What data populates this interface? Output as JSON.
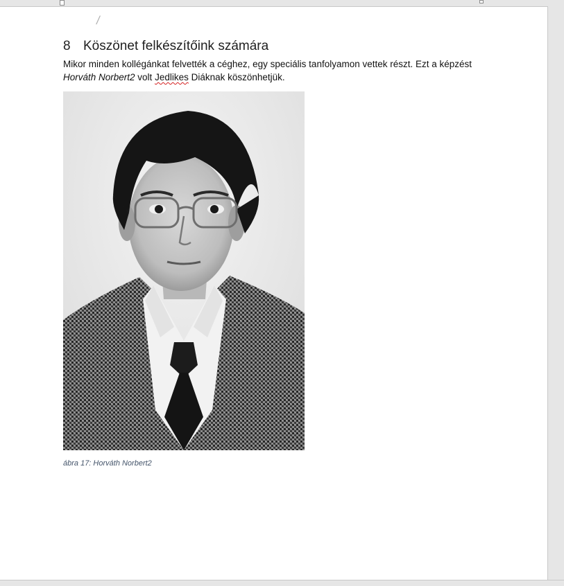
{
  "document": {
    "heading": {
      "number": "8",
      "title": "Köszönet felkészítőink számára"
    },
    "paragraph": {
      "line1": "Mikor minden kollégánkat felvették a céghez, egy speciális tanfolyamon vettek részt. Ezt a képzést",
      "name_italic": "Horváth Norbert2",
      "mid": " volt ",
      "misspelled_word": "Jedlikes",
      "end": " Diáknak köszönhetjük."
    },
    "figure": {
      "alt": "Horváth Norbert2",
      "caption": "ábra 17: Horváth Norbert2"
    },
    "page_corner_mark": "/"
  },
  "colors": {
    "caption": "#44546a",
    "spellcheck_underline": "#d42020",
    "chrome_gray": "#e6e6e6"
  }
}
